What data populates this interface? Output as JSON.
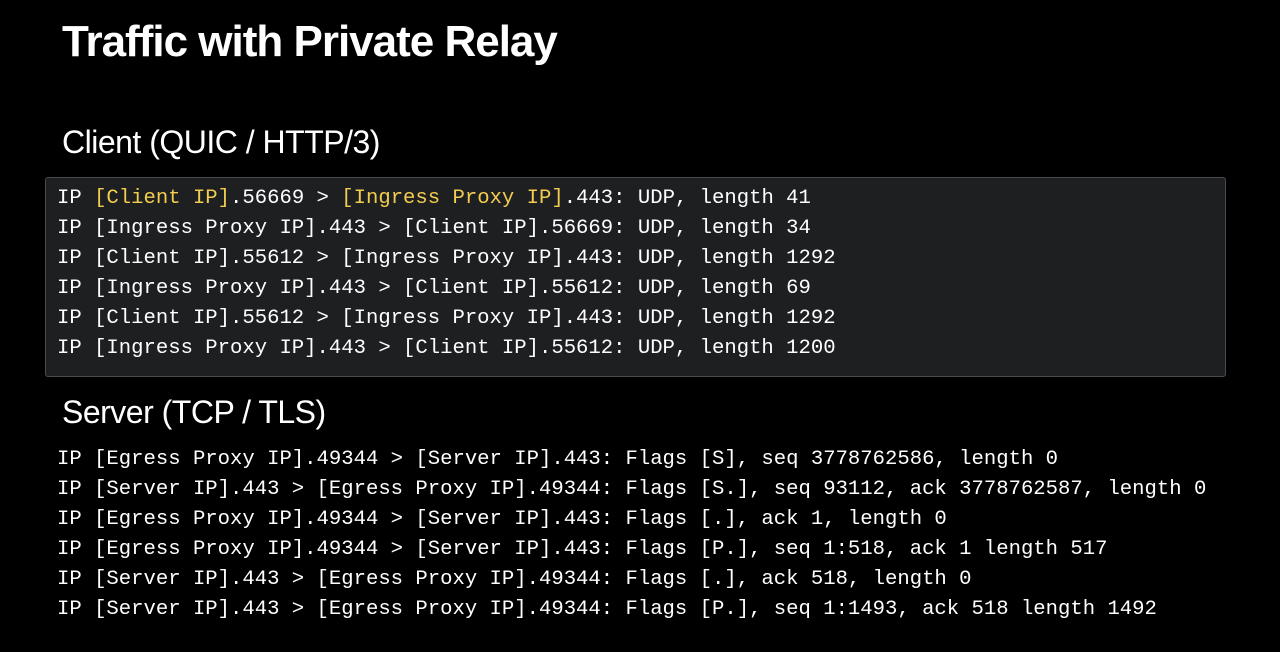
{
  "slide": {
    "title": "Traffic with Private Relay"
  },
  "colors": {
    "background": "#000000",
    "panel": "#1e1f21",
    "panel_border": "#4a4b4e",
    "text": "#ffffff",
    "highlight": "#f3cd4f"
  },
  "client": {
    "heading": "Client (QUIC / HTTP/3)",
    "first_line": {
      "prefix": "IP ",
      "client_ip": "[Client IP]",
      "mid": ".56669 > ",
      "ingress_ip": "[Ingress Proxy IP]",
      "suffix": ".443: UDP, length 41"
    },
    "lines": [
      "IP [Ingress Proxy IP].443 > [Client IP].56669: UDP, length 34",
      "IP [Client IP].55612 > [Ingress Proxy IP].443: UDP, length 1292",
      "IP [Ingress Proxy IP].443 > [Client IP].55612: UDP, length 69",
      "IP [Client IP].55612 > [Ingress Proxy IP].443: UDP, length 1292",
      "IP [Ingress Proxy IP].443 > [Client IP].55612: UDP, length 1200"
    ]
  },
  "server": {
    "heading": "Server (TCP / TLS)",
    "lines": [
      "IP [Egress Proxy IP].49344 > [Server IP].443: Flags [S], seq 3778762586, length 0",
      "IP [Server IP].443 > [Egress Proxy IP].49344: Flags [S.], seq 93112, ack 3778762587, length 0",
      "IP [Egress Proxy IP].49344 > [Server IP].443: Flags [.], ack 1, length 0",
      "IP [Egress Proxy IP].49344 > [Server IP].443: Flags [P.], seq 1:518, ack 1 length 517",
      "IP [Server IP].443 > [Egress Proxy IP].49344: Flags [.], ack 518, length 0",
      "IP [Server IP].443 > [Egress Proxy IP].49344: Flags [P.], seq 1:1493, ack 518 length 1492"
    ]
  }
}
